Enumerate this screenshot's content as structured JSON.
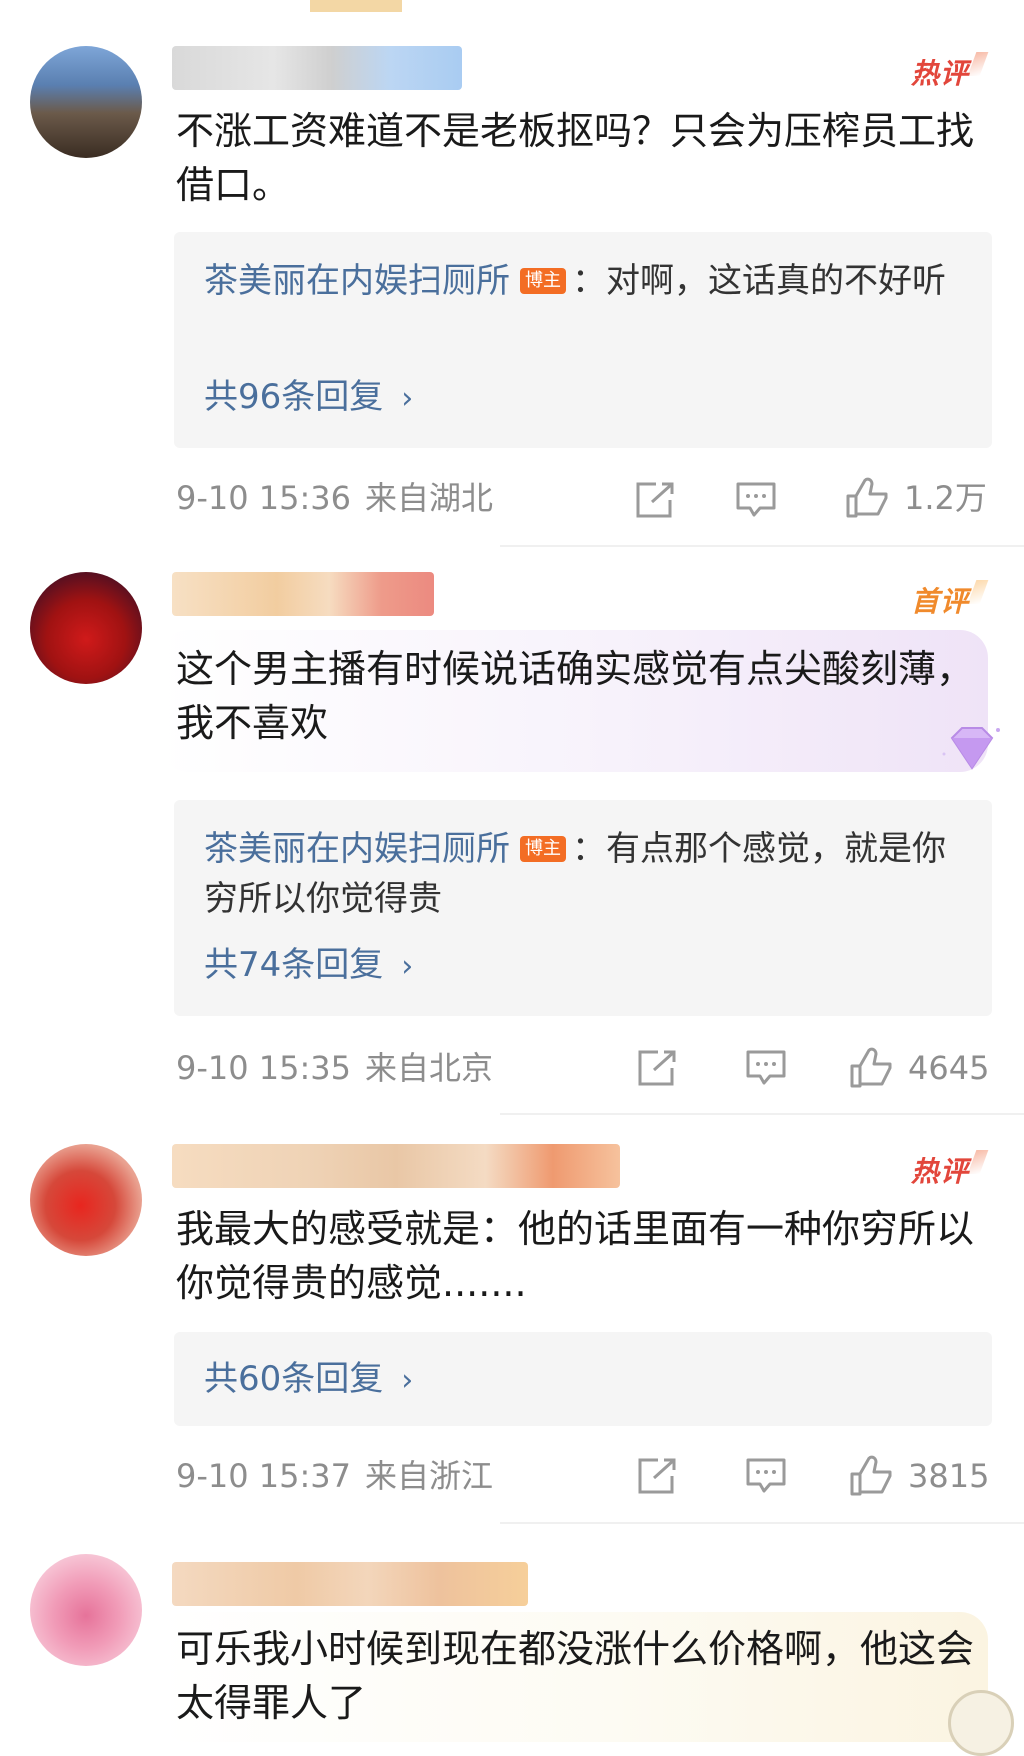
{
  "comments": [
    {
      "badge": "热评",
      "text": "不涨工资难道不是老板抠吗？只会为压榨员工找借口。",
      "reply_author": "茶美丽在内娱扫厕所",
      "host_tag": "博主",
      "reply_text": "：对啊，这话真的不好听",
      "reply_count": "共96条回复",
      "time": "9-10 15:36",
      "location": "来自湖北",
      "likes": "1.2万"
    },
    {
      "badge": "首评",
      "text": "这个男主播有时候说话确实感觉有点尖酸刻薄，我不喜欢",
      "reply_author": "茶美丽在内娱扫厕所",
      "host_tag": "博主",
      "reply_text": "：有点那个感觉，就是你穷所以你觉得贵",
      "reply_count": "共74条回复",
      "time": "9-10 15:35",
      "location": "来自北京",
      "likes": "4645"
    },
    {
      "badge": "热评",
      "text": "我最大的感受就是：他的话里面有一种你穷所以你觉得贵的感觉.......",
      "reply_count": "共60条回复",
      "time": "9-10 15:37",
      "location": "来自浙江",
      "likes": "3815"
    },
    {
      "text": "可乐我小时候到现在都没涨什么价格啊，他这会太得罪人了"
    }
  ],
  "icons": {
    "share": "share-icon",
    "comment": "comment-icon",
    "like": "like-icon",
    "chevron": "chevron-right-icon",
    "gem": "diamond-gem-icon"
  },
  "colors": {
    "link_blue": "#4a6f9c",
    "hot_red": "#e2463b",
    "first_orange": "#f08a2c",
    "host_orange": "#f36d24",
    "meta_gray": "#8d8d8d",
    "reply_bg": "#f5f5f5"
  }
}
